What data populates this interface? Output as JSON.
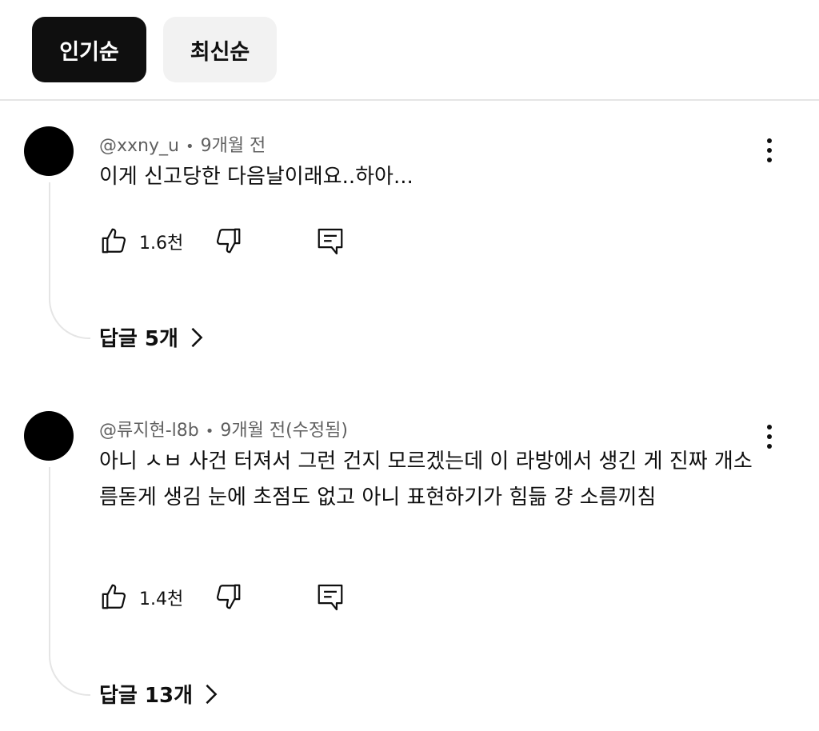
{
  "sort": {
    "popular": "인기순",
    "newest": "최신순"
  },
  "comments": [
    {
      "author": "@xxny_u",
      "time": "9개월 전",
      "text": "이게 신고당한 다음날이래요..하아...",
      "likes": "1.6천",
      "replies": "답글 5개"
    },
    {
      "author": "@류지현-l8b",
      "time": "9개월 전(수정됨)",
      "text": "아니 ㅅㅂ 사건 터져서 그런 건지 모르겠는데 이 라방에서 생긴 게 진짜 개소름돋게 생김 눈에 초점도 없고 아니 표현하기가 힘듦 걍 소름끼침",
      "likes": "1.4천",
      "replies": "답글 13개"
    }
  ],
  "icons": {
    "like": "thumb-up-icon",
    "dislike": "thumb-down-icon",
    "reply": "reply-icon",
    "more": "more-vert-icon",
    "chevron": "chevron-right-icon"
  }
}
